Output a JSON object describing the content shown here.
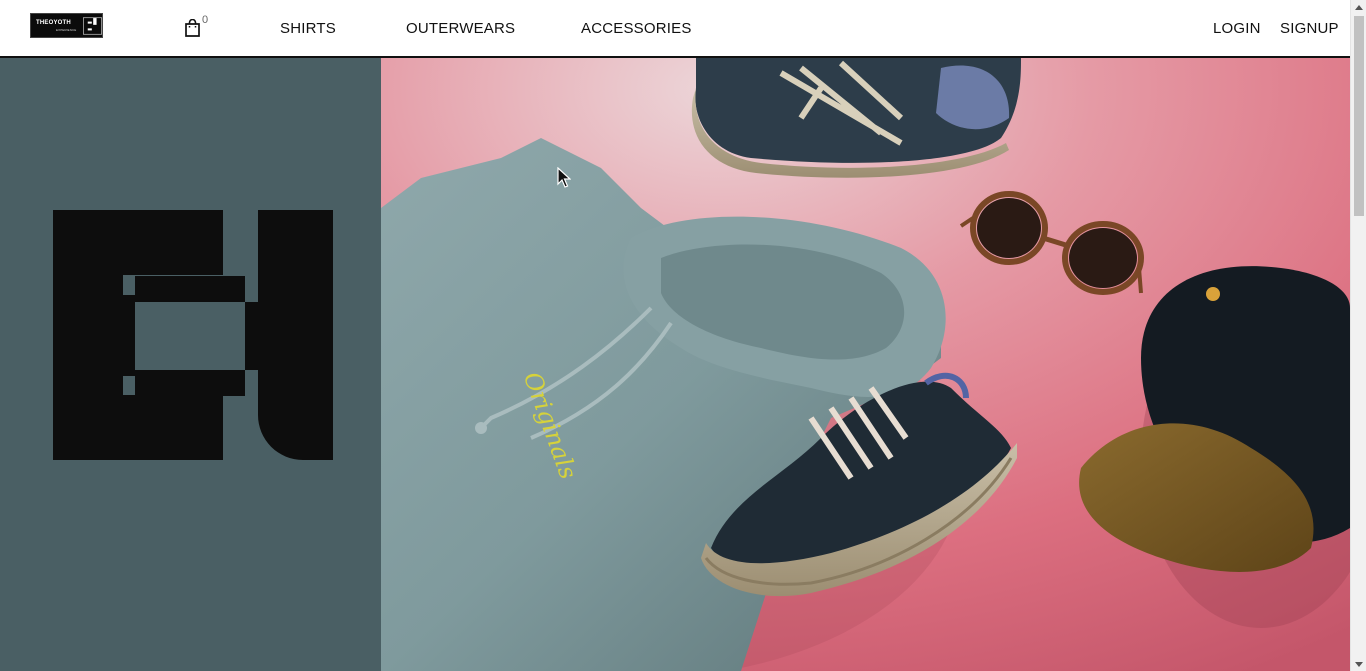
{
  "header": {
    "logo": {
      "word": "THEOYOTH",
      "sub": "EXPERIENCE",
      "icon": "brand-eh-logo"
    },
    "cart": {
      "icon": "shopping-bag-icon",
      "count": "0"
    },
    "nav": {
      "shirts": "SHIRTS",
      "outerwears": "OUTERWEARS",
      "accessories": "ACCESSORIES"
    },
    "auth": {
      "login": "LOGIN",
      "signup": "SIGNUP"
    }
  },
  "hero": {
    "brand_icon": "brand-eh-mark",
    "left_panel_color": "#4a5f64",
    "image": {
      "subject": "flat-lay of hoodie, sneakers, sunglasses and cap on pink background",
      "hoodie_print": "Originals",
      "background_color": "#db6f7e"
    }
  },
  "colors": {
    "text": "#111111",
    "border": "#111111",
    "panel": "#4a5f64"
  }
}
